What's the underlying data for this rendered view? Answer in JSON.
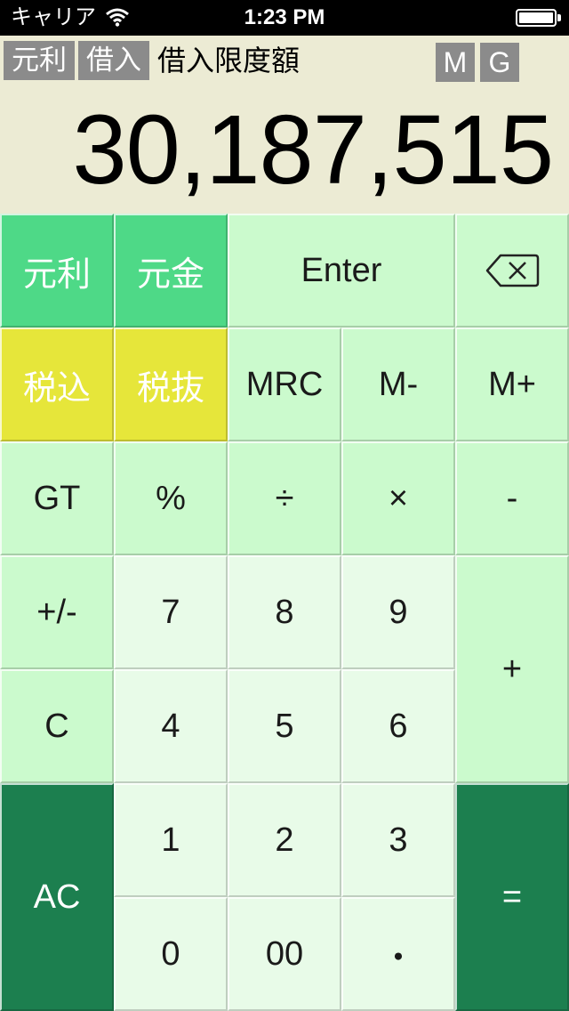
{
  "status_bar": {
    "carrier": "キャリア",
    "time": "1:23 PM"
  },
  "display": {
    "mode_tags": [
      "元利",
      "借入"
    ],
    "mode_label": "借入限度額",
    "flags": [
      "M",
      "G"
    ],
    "value": "30,187,515"
  },
  "keys": {
    "ganri": "元利",
    "gankin": "元金",
    "enter": "Enter",
    "zeikomi": "税込",
    "zeinuki": "税抜",
    "mrc": "MRC",
    "m_minus": "M-",
    "m_plus": "M+",
    "gt": "GT",
    "percent": "%",
    "divide": "÷",
    "multiply": "×",
    "minus": "-",
    "sign": "+/-",
    "seven": "7",
    "eight": "8",
    "nine": "9",
    "plus": "+",
    "clear": "C",
    "four": "4",
    "five": "5",
    "six": "6",
    "all_clear": "AC",
    "one": "1",
    "two": "2",
    "three": "3",
    "equals": "=",
    "zero": "0",
    "double_zero": "00",
    "decimal": "・"
  },
  "colors": {
    "function_green": "#4ed987",
    "tax_yellow": "#e6e63a",
    "operator_light": "#cbfacd",
    "digit_pale": "#e8fbe8",
    "action_dark": "#1c7f4f",
    "display_bg": "#ecebd4",
    "tag_gray": "#8b8b8b"
  }
}
